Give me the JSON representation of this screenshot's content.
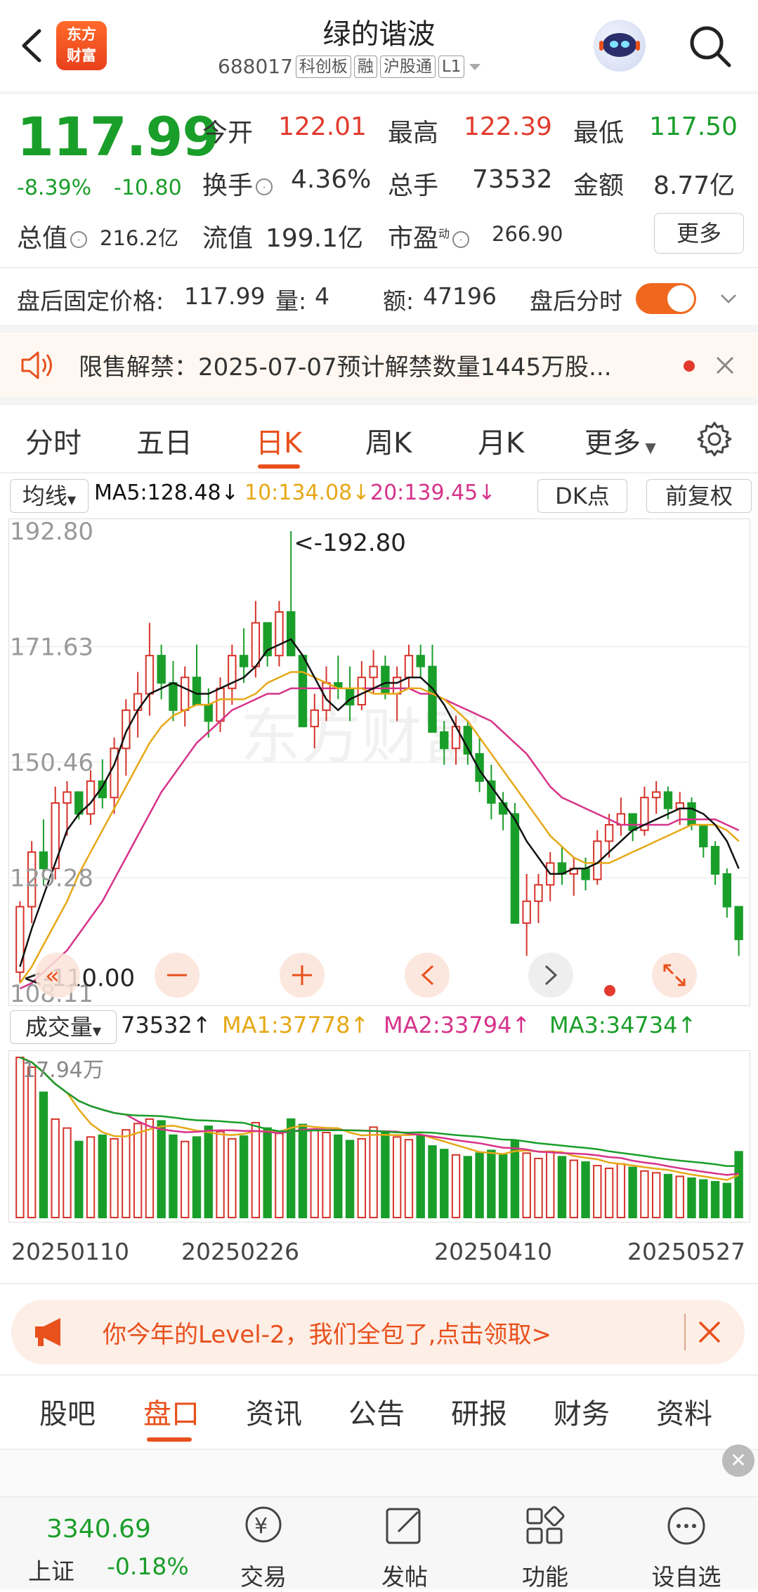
{
  "header": {
    "title": "绿的谐波",
    "code": "688017",
    "tags": [
      "科创板",
      "融",
      "沪股通",
      "L1"
    ],
    "logo_line1": "东方",
    "logo_line2": "财富"
  },
  "quote": {
    "price": "117.99",
    "change_pct": "-8.39%",
    "change": "-10.80",
    "open_label": "今开",
    "open": "122.01",
    "high_label": "最高",
    "high": "122.39",
    "low_label": "最低",
    "low": "117.50",
    "turnover_label": "换手",
    "turnover": "4.36%",
    "volume_label": "总手",
    "volume": "73532",
    "amount_label": "金额",
    "amount": "8.77亿",
    "mktcap_label": "总值",
    "mktcap": "216.2亿",
    "float_label": "流值",
    "float": "199.1亿",
    "pe_label": "市盈",
    "pe_sup": "动",
    "pe": "266.90",
    "more_label": "更多"
  },
  "after_hours": {
    "label": "盘后固定价格:",
    "price": "117.99",
    "vol_label": "量:",
    "vol": "4",
    "amt_label": "额:",
    "amt": "47196",
    "toggle_label": "盘后分时"
  },
  "notice": {
    "text": "限售解禁：2025-07-07预计解禁数量1445万股..."
  },
  "ktabs": [
    "分时",
    "五日",
    "日K",
    "周K",
    "月K",
    "更多"
  ],
  "ma": {
    "selector": "均线",
    "ma5": "MA5:128.48↓",
    "ma10": "10:134.08↓",
    "ma20": "20:139.45↓",
    "dk_label": "DK点",
    "adjust_label": "前复权",
    "colors": {
      "ma5": "#111111",
      "ma10": "#e6a817",
      "ma20": "#d6338a",
      "up": "#d6332a",
      "down": "#1a9e2a"
    }
  },
  "chart_data": {
    "type": "candlestick",
    "y_ticks": [
      "192.80",
      "171.63",
      "150.46",
      "129.28",
      "108.11"
    ],
    "ylim": [
      108.11,
      192.8
    ],
    "high_marker": "<-192.80",
    "low_marker": "<-110.00",
    "watermark": "东方财富",
    "candles_ohlc": [
      [
        112,
        125,
        110,
        124
      ],
      [
        124,
        136,
        121,
        134
      ],
      [
        134,
        140,
        128,
        131
      ],
      [
        131,
        146,
        129,
        143
      ],
      [
        143,
        147,
        137,
        145
      ],
      [
        145,
        144,
        140,
        141
      ],
      [
        141,
        149,
        139,
        147
      ],
      [
        147,
        151,
        142,
        144
      ],
      [
        144,
        155,
        141,
        153
      ],
      [
        153,
        162,
        148,
        160
      ],
      [
        160,
        167,
        155,
        163
      ],
      [
        163,
        176,
        159,
        170
      ],
      [
        170,
        172,
        162,
        165
      ],
      [
        165,
        169,
        158,
        160
      ],
      [
        160,
        168,
        157,
        166
      ],
      [
        166,
        172,
        162,
        161
      ],
      [
        161,
        164,
        155,
        158
      ],
      [
        158,
        166,
        156,
        164
      ],
      [
        164,
        172,
        161,
        170
      ],
      [
        170,
        175,
        165,
        168
      ],
      [
        168,
        180,
        166,
        176
      ],
      [
        176,
        174,
        168,
        170
      ],
      [
        170,
        180,
        168,
        178
      ],
      [
        178,
        192.8,
        175,
        170
      ],
      [
        170,
        168,
        160,
        157
      ],
      [
        157,
        163,
        153,
        160
      ],
      [
        160,
        168,
        158,
        165
      ],
      [
        165,
        170,
        162,
        164
      ],
      [
        164,
        168,
        158,
        161
      ],
      [
        161,
        169,
        160,
        166
      ],
      [
        166,
        171,
        163,
        168
      ],
      [
        168,
        170,
        162,
        163
      ],
      [
        163,
        168,
        158,
        166
      ],
      [
        166,
        172,
        164,
        170
      ],
      [
        170,
        172,
        166,
        168
      ],
      [
        168,
        172,
        160,
        156
      ],
      [
        156,
        158,
        150,
        153
      ],
      [
        153,
        159,
        150,
        157
      ],
      [
        157,
        158,
        150,
        152
      ],
      [
        152,
        155,
        145,
        147
      ],
      [
        147,
        150,
        140,
        143
      ],
      [
        143,
        145,
        138,
        141
      ],
      [
        141,
        143,
        125,
        121
      ],
      [
        121,
        130,
        115,
        125
      ],
      [
        125,
        130,
        121,
        128
      ],
      [
        128,
        134,
        125,
        132
      ],
      [
        132,
        135,
        128,
        130
      ],
      [
        130,
        133,
        126,
        131
      ],
      [
        131,
        133,
        127,
        129
      ],
      [
        129,
        138,
        128,
        136
      ],
      [
        136,
        141,
        133,
        139
      ],
      [
        139,
        144,
        137,
        141
      ],
      [
        141,
        140,
        136,
        138
      ],
      [
        138,
        146,
        137,
        144
      ],
      [
        144,
        147,
        141,
        145
      ],
      [
        145,
        146,
        140,
        142
      ],
      [
        142,
        145,
        139,
        143
      ],
      [
        143,
        144,
        138,
        139
      ],
      [
        139,
        138,
        133,
        135
      ],
      [
        135,
        136,
        128,
        130
      ],
      [
        130,
        131,
        122,
        124
      ],
      [
        124,
        122,
        115,
        118
      ]
    ],
    "ma5": [
      113,
      120,
      126,
      132,
      138,
      141,
      143,
      146,
      150,
      156,
      160,
      163,
      164,
      165,
      164,
      163,
      163,
      164,
      165,
      166,
      168,
      171,
      172,
      173,
      170,
      166,
      162,
      160,
      162,
      163,
      164,
      165,
      165,
      166,
      166,
      164,
      161,
      157,
      153,
      149,
      146,
      143,
      140,
      136,
      133,
      130,
      130,
      131,
      131,
      132,
      134,
      136,
      138,
      139,
      140,
      141,
      142,
      142,
      141,
      139,
      136,
      131
    ],
    "ma10": [
      110,
      113,
      117,
      121,
      125,
      130,
      134,
      138,
      142,
      146,
      150,
      154,
      157,
      159,
      160,
      161,
      161,
      162,
      162,
      162,
      163,
      165,
      166,
      167,
      167,
      166,
      165,
      164,
      164,
      164,
      163,
      163,
      163,
      164,
      164,
      163,
      162,
      160,
      158,
      155,
      152,
      149,
      146,
      143,
      140,
      137,
      135,
      133,
      132,
      132,
      132,
      133,
      134,
      135,
      136,
      137,
      138,
      139,
      139,
      139,
      138,
      136
    ],
    "ma20": [
      109,
      110,
      112,
      114,
      116,
      119,
      122,
      125,
      129,
      133,
      137,
      141,
      145,
      148,
      151,
      154,
      156,
      158,
      160,
      161,
      162,
      163,
      163,
      164,
      164,
      164,
      164,
      164,
      164,
      164,
      164,
      164,
      164,
      164,
      163,
      163,
      162,
      161,
      160,
      159,
      158,
      156,
      154,
      152,
      149,
      146,
      144,
      143,
      142,
      141,
      140,
      139,
      139,
      139,
      139,
      139,
      140,
      140,
      140,
      140,
      139,
      138
    ],
    "volume": {
      "label": "成交量",
      "value": "73532↑",
      "ma1": "MA1:37778↑",
      "ma2": "MA2:33794↑",
      "ma3": "MA3:34734↑",
      "max_label": "17.94万",
      "colors": {
        "ma1": "#e6a817",
        "ma2": "#d6338a",
        "ma3": "#1a9e2a"
      },
      "values": [
        179000,
        168000,
        140000,
        110000,
        100000,
        85000,
        90000,
        92000,
        88000,
        98000,
        105000,
        110000,
        108000,
        92000,
        85000,
        90000,
        102000,
        96000,
        88000,
        91000,
        106000,
        100000,
        94000,
        110000,
        104000,
        98000,
        95000,
        92000,
        86000,
        88000,
        101000,
        95000,
        90000,
        87000,
        92000,
        80000,
        76000,
        70000,
        68000,
        72000,
        75000,
        70000,
        86000,
        72000,
        66000,
        74000,
        68000,
        64000,
        62000,
        58000,
        55000,
        60000,
        56000,
        52000,
        50000,
        48000,
        46000,
        44000,
        42000,
        40000,
        38000,
        73532
      ]
    },
    "dates": [
      "20250110",
      "20250226",
      "20250410",
      "20250527"
    ]
  },
  "promo": {
    "text": "你今年的Level-2，我们全包了,点击领取>"
  },
  "bottom_tabs": [
    "股吧",
    "盘口",
    "资讯",
    "公告",
    "研报",
    "财务",
    "资料"
  ],
  "index": {
    "value": "3340.69",
    "name": "上证",
    "change": "-0.18%"
  },
  "nav": [
    "交易",
    "发帖",
    "功能",
    "设自选"
  ]
}
